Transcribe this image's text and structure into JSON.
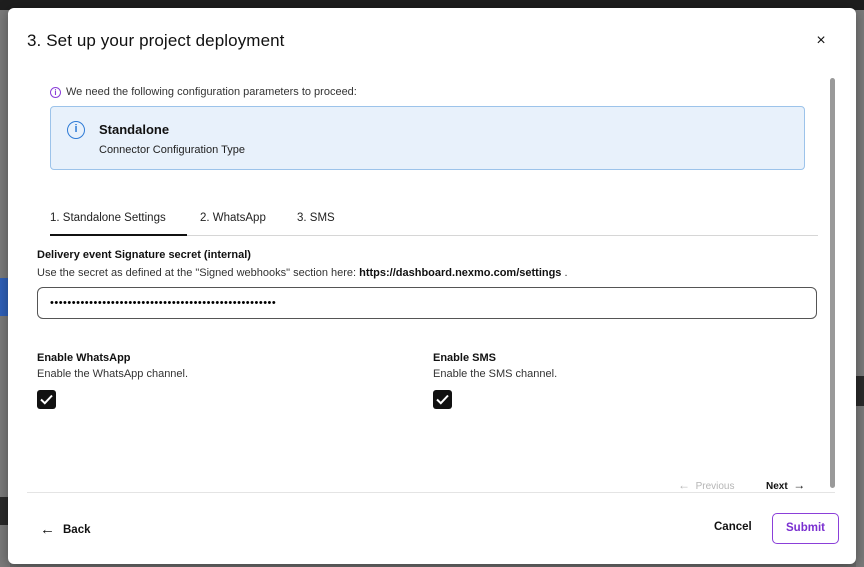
{
  "modal": {
    "title": "3. Set up your project deployment",
    "close_label": "×"
  },
  "notice": {
    "icon": "i",
    "text": "We need the following configuration parameters to proceed:"
  },
  "info_box": {
    "icon": "i",
    "title": "Standalone",
    "subtitle": "Connector Configuration Type"
  },
  "tabs": [
    {
      "label": "1. Standalone Settings",
      "active": true
    },
    {
      "label": "2. WhatsApp",
      "active": false
    },
    {
      "label": "3. SMS",
      "active": false
    }
  ],
  "secret_field": {
    "label": "Delivery event Signature secret (internal)",
    "help_prefix": "Use the secret as defined at the \"Signed webhooks\" section here: ",
    "help_link": "https://dashboard.nexmo.com/settings",
    "help_suffix": " .",
    "value": "••••••••••••••••••••••••••••••••••••••••••••••••••••"
  },
  "whatsapp_toggle": {
    "label": "Enable WhatsApp",
    "help": "Enable the WhatsApp channel.",
    "checked": true
  },
  "sms_toggle": {
    "label": "Enable SMS",
    "help": "Enable the SMS channel.",
    "checked": true
  },
  "pager": {
    "previous_arrow": "←",
    "previous_label": "Previous",
    "next_label": "Next",
    "next_arrow": "→"
  },
  "footer": {
    "back_arrow": "←",
    "back_label": "Back",
    "cancel_label": "Cancel",
    "submit_label": "Submit"
  },
  "colors": {
    "accent": "#8b3fd9",
    "info_bg": "#e8f1fb",
    "info_border": "#9cc3ea"
  }
}
